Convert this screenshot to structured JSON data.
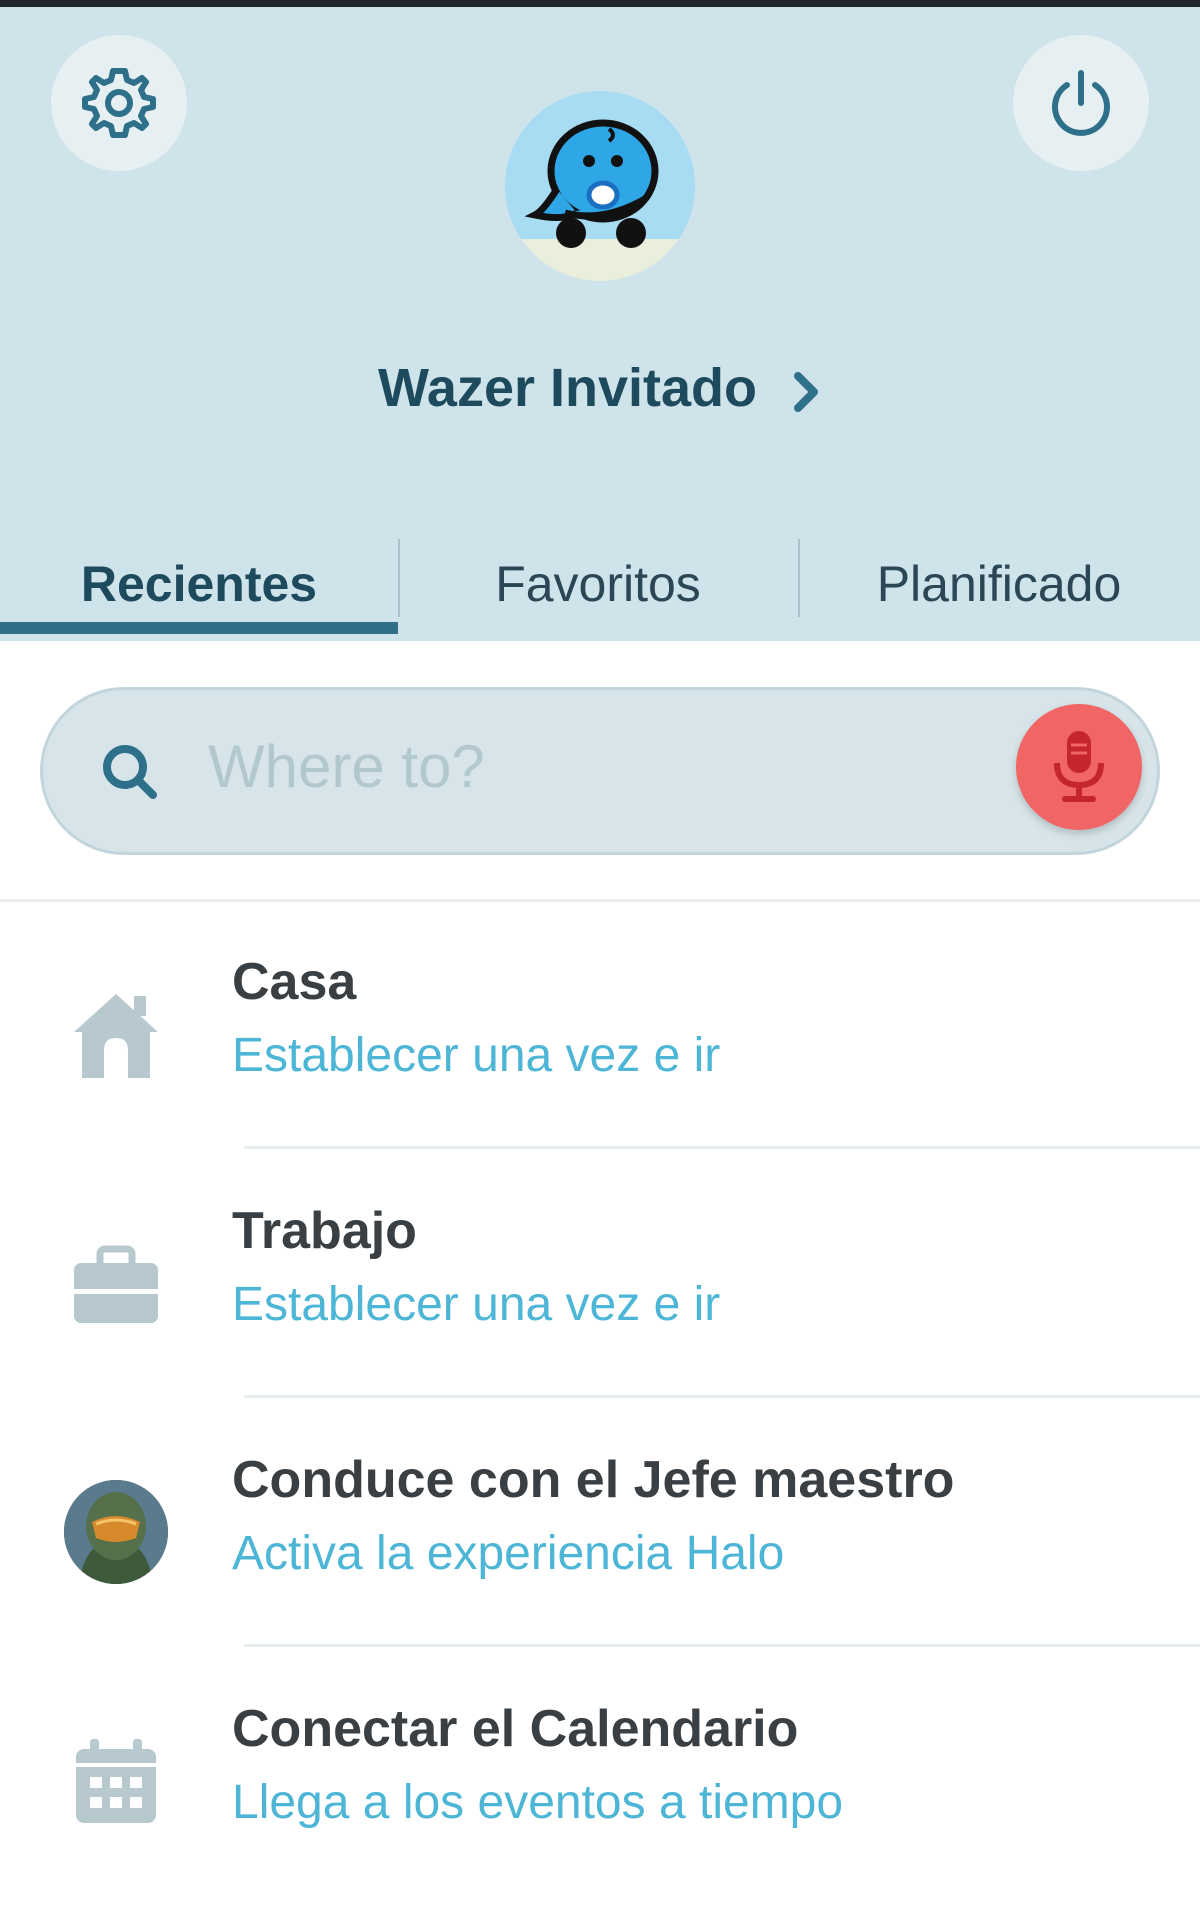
{
  "header": {
    "username": "Wazer Invitado"
  },
  "tabs": [
    {
      "label": "Recientes",
      "active": true
    },
    {
      "label": "Favoritos",
      "active": false
    },
    {
      "label": "Planificado",
      "active": false
    }
  ],
  "search": {
    "placeholder": "Where to?"
  },
  "items": [
    {
      "title": "Casa",
      "subtitle": "Establecer una vez e ir",
      "icon": "home-icon"
    },
    {
      "title": "Trabajo",
      "subtitle": "Establecer una vez e ir",
      "icon": "briefcase-icon"
    },
    {
      "title": "Conduce con el Jefe maestro",
      "subtitle": "Activa la experiencia Halo",
      "icon": "halo-avatar"
    },
    {
      "title": "Conectar el Calendario",
      "subtitle": "Llega a los eventos a tiempo",
      "icon": "calendar-icon"
    }
  ],
  "colors": {
    "header_bg": "#cfe3ea",
    "accent": "#2f6f8a",
    "subtitle": "#4db6d6",
    "mic": "#f16565"
  }
}
